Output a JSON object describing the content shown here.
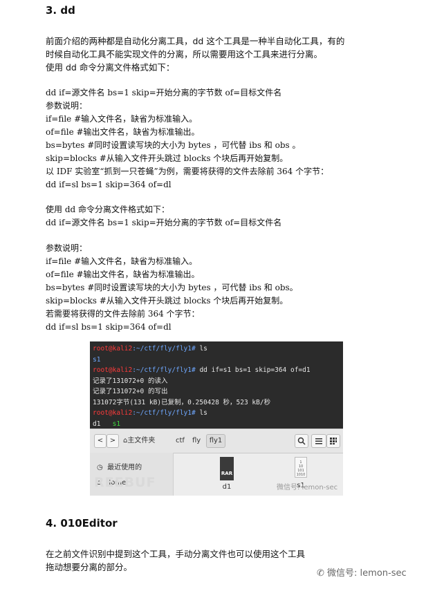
{
  "section3_title": "3. dd",
  "intro_line1": "前面介绍的两种都是自动化分离工具，dd 这个工具是一种半自动化工具，有的",
  "intro_line2": "时候自动化工具不能实现文件的分离，所以需要用这个工具来进行分离。",
  "intro_line3": "使用 dd 命令分离文件格式如下：",
  "block1": [
    "dd if=源文件名 bs=1 skip=开始分离的字节数 of=目标文件名",
    "参数说明：",
    "if=file #输入文件名，缺省为标准输入。",
    "of=file #输出文件名，缺省为标准输出。",
    "bs=bytes #同时设置读写块的大小为 bytes ，可代替 ibs 和 obs 。",
    "skip=blocks #从输入文件开头跳过 blocks 个块后再开始复制。",
    "以 IDF 实验室“抓到一只苍蝇”为例，需要将获得的文件去除前 364 个字节：",
    "dd if=sl bs=1 skip=364 of=dl"
  ],
  "block2": [
    "使用 dd 命令分离文件格式如下：",
    "dd if=源文件名 bs=1 skip=开始分离的字节数 of=目标文件名"
  ],
  "block3": [
    "参数说明：",
    "if=file #输入文件名，缺省为标准输入。",
    "of=file #输出文件名，缺省为标准输出。",
    "bs=bytes #同时设置读写块的大小为 bytes ，可代替 ibs 和 obs。",
    "skip=blocks #从输入文件开头跳过 blocks 个块后再开始复制。",
    "若需要将获得的文件去除前 364 个字节：",
    "dd if=sl bs=1 skip=364 of=dl"
  ],
  "terminal": {
    "prompt_user": "root@kali2",
    "prompt_path": ":~/ctf/fly/fly1#",
    "cmd1": " ls",
    "out1": "s1",
    "cmd2": " dd if=s1 bs=1 skip=364 of=d1",
    "out2a": "记录了131072+0 的读入",
    "out2b": "记录了131072+0 的写出",
    "out2c": "131072字节(131 kB)已复制，0.250428 秒，523 kB/秒",
    "cmd3": " ls",
    "out3_d1": "d1",
    "out3_s1": "s1"
  },
  "file_manager": {
    "back": "<",
    "forward": ">",
    "crumbs": [
      "⌂主文件夹",
      "ctf",
      "fly",
      "fly1"
    ],
    "side_recent": "最近使用的",
    "side_home": "Home",
    "file1_type": "RAR",
    "file1_name": "d1",
    "file2_name": "s1",
    "watermark_small": "微信号: lemon-sec",
    "watermark_faded": "REEBUF"
  },
  "section4_title": "4. 010Editor",
  "outro_line1": "在之前文件识别中提到这个工具，手动分离文件也可以使用这个工具",
  "outro_line2": "拖动想要分离的部分。",
  "footer_watermark": "微信号: lemon-sec"
}
